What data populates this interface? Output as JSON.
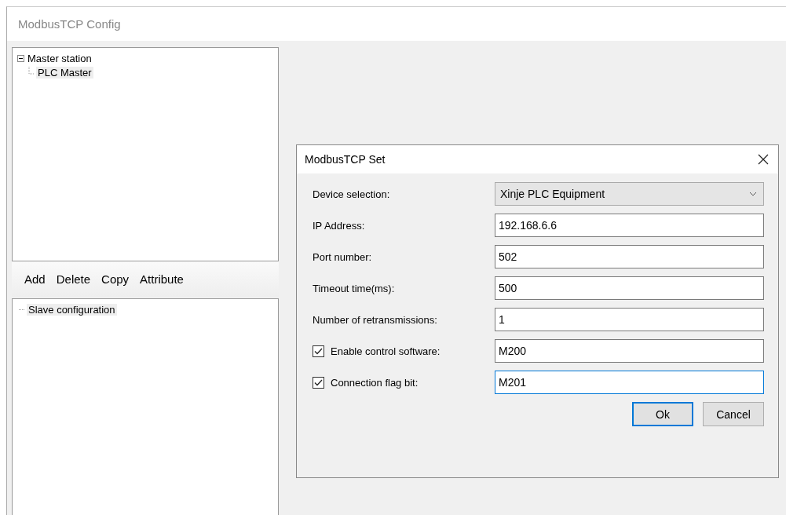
{
  "window": {
    "title": "ModbusTCP Config"
  },
  "master_tree": [
    {
      "label": "Master station",
      "expanded": true,
      "children": [
        {
          "label": "PLC Master",
          "selected": true
        }
      ]
    }
  ],
  "toolbar": [
    "Add",
    "Delete",
    "Copy",
    "Attribute"
  ],
  "slave_tree": [
    {
      "label": "Slave configuration",
      "selected": true
    }
  ],
  "dialog": {
    "title": "ModbusTCP Set",
    "rows": [
      {
        "kind": "select",
        "label": "Device selection:",
        "value": "Xinje PLC Equipment"
      },
      {
        "kind": "text",
        "label": "IP Address:",
        "value": "192.168.6.6",
        "focused": false
      },
      {
        "kind": "text",
        "label": "Port number:",
        "value": "502",
        "focused": false
      },
      {
        "kind": "text",
        "label": "Timeout time(ms):",
        "value": "500",
        "focused": false
      },
      {
        "kind": "text",
        "label": "Number of retransmissions:",
        "value": "1",
        "focused": false
      },
      {
        "kind": "checkbox",
        "label": "Enable control software:",
        "checked": true,
        "value": "M200",
        "focused": false
      },
      {
        "kind": "checkbox",
        "label": "Connection flag bit:",
        "checked": true,
        "value": "M201",
        "focused": true
      }
    ],
    "buttons": [
      {
        "label": "Ok",
        "default": true
      },
      {
        "label": "Cancel",
        "default": false
      }
    ]
  }
}
